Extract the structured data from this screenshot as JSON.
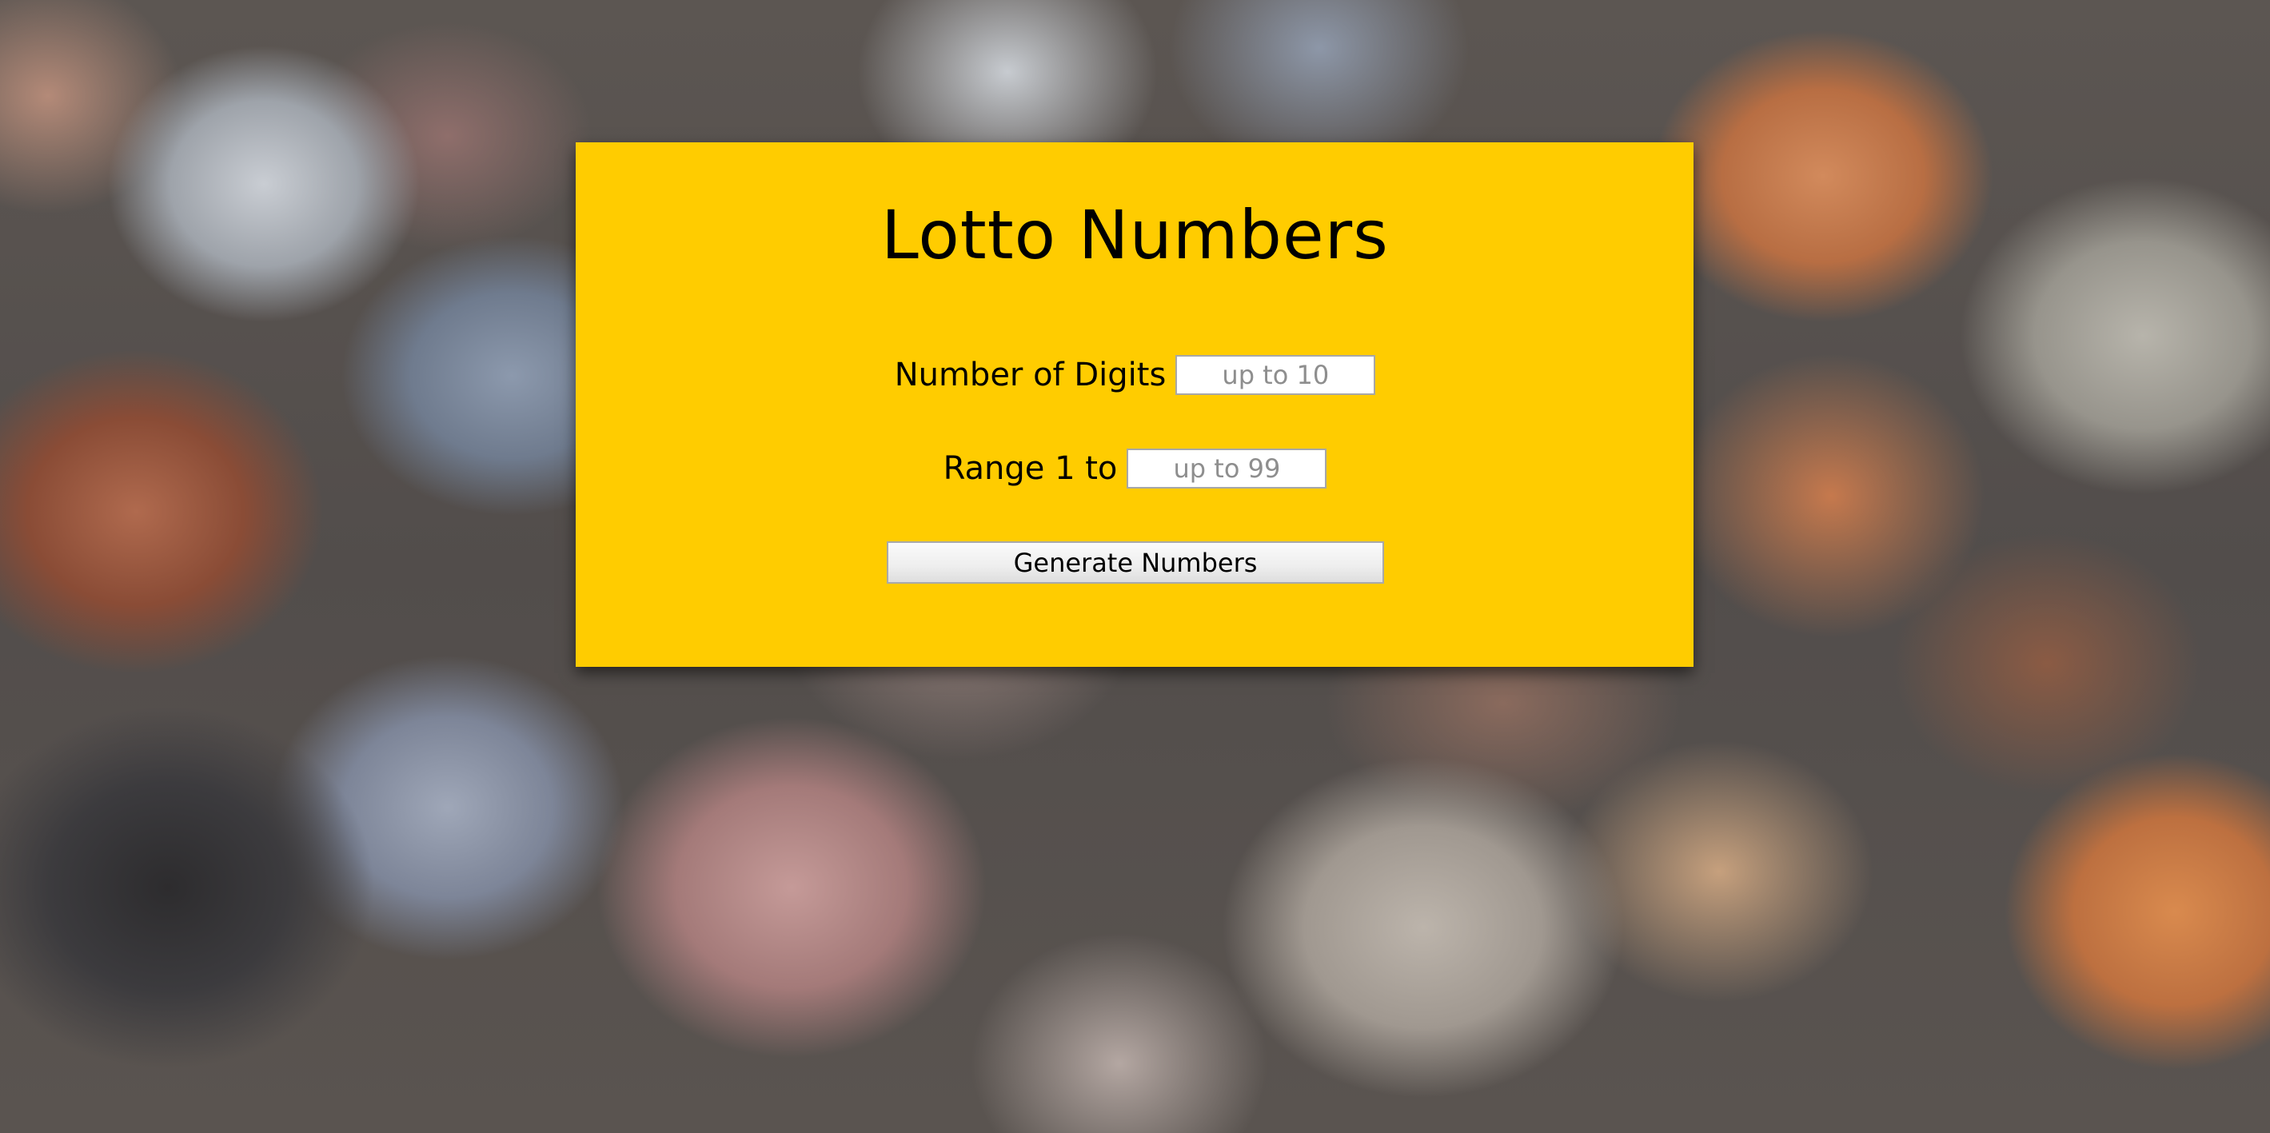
{
  "app": {
    "title": "Lotto Numbers",
    "accent_color": "#ffcc00"
  },
  "form": {
    "digits": {
      "label": "Number of Digits",
      "placeholder": "up to 10",
      "value": ""
    },
    "range": {
      "label": "Range 1 to",
      "placeholder": "up to 99",
      "value": ""
    },
    "generate_label": "Generate Numbers"
  }
}
